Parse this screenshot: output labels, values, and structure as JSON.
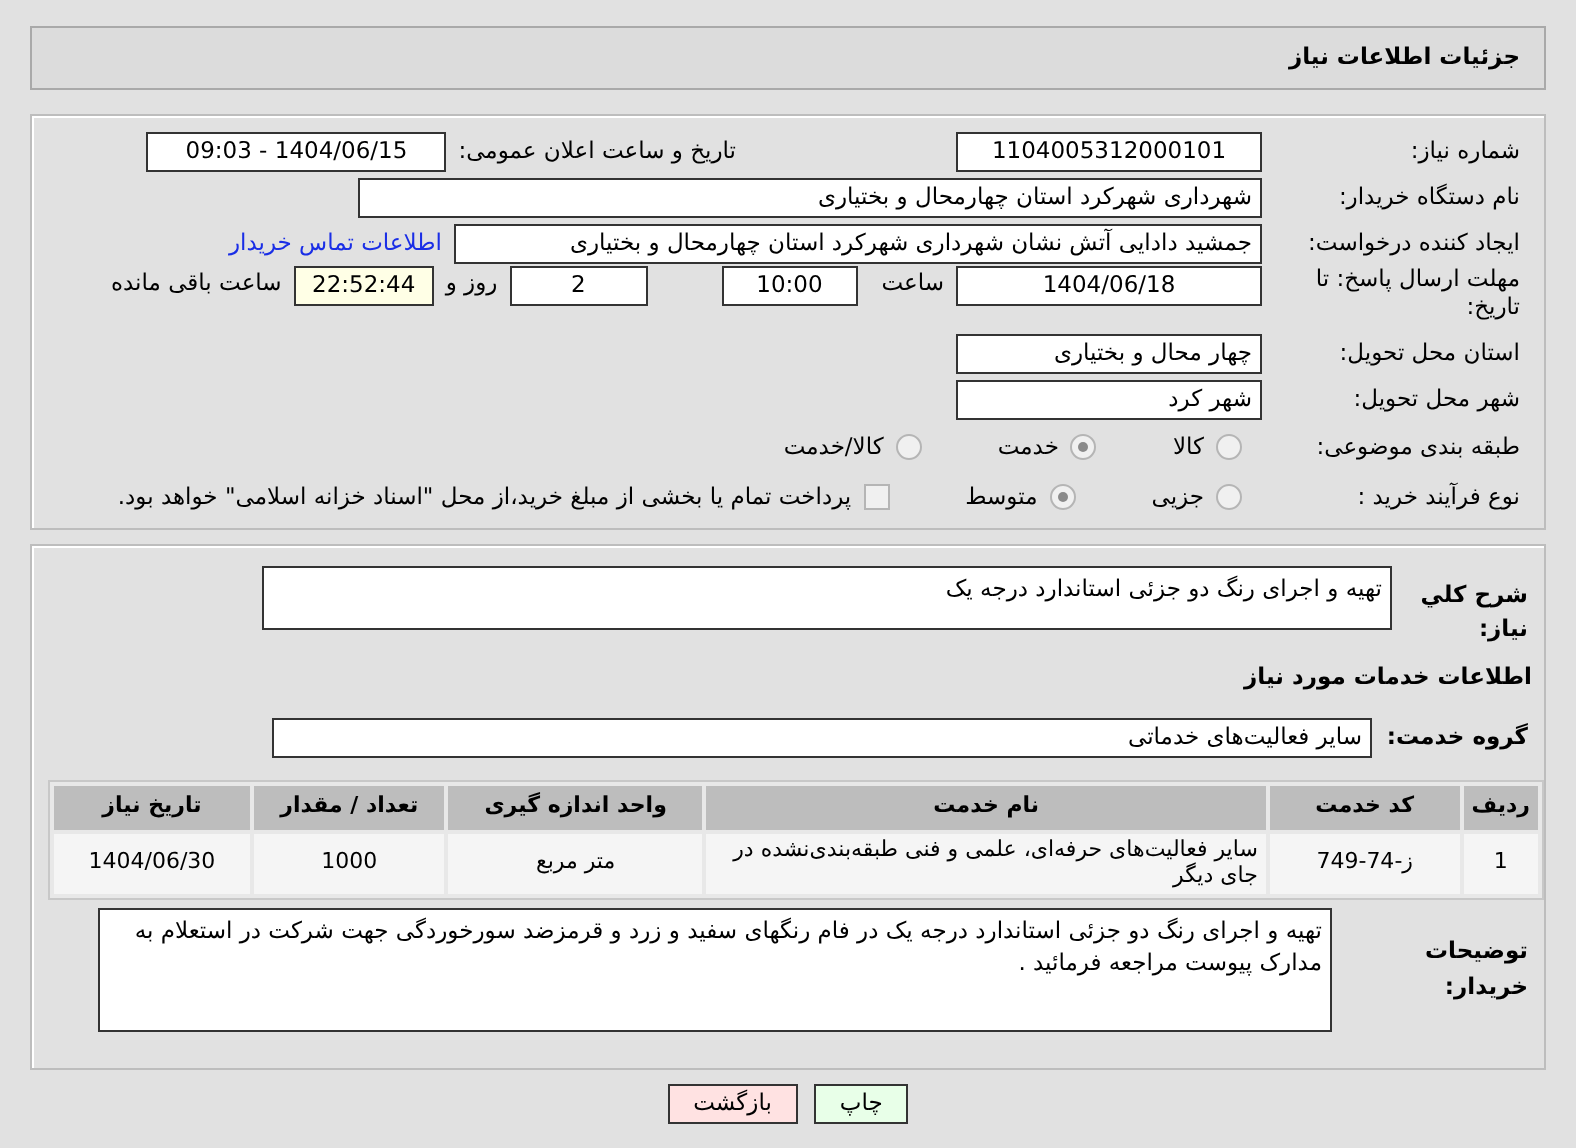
{
  "header": {
    "title": "جزئیات اطلاعات نیاز"
  },
  "need_number": {
    "label": "شماره نیاز:",
    "value": "1104005312000101"
  },
  "announce": {
    "label": "تاریخ و ساعت اعلان عمومی:",
    "value": "1404/06/15 - 09:03"
  },
  "buyer_org": {
    "label": "نام دستگاه خریدار:",
    "value": "شهرداری شهرکرد استان چهارمحال و بختیاری"
  },
  "requester": {
    "label": "ایجاد کننده درخواست:",
    "value": "جمشید دادایی آتش نشان شهرداری شهرکرد استان چهارمحال و بختیاری",
    "link": "اطلاعات تماس خریدار"
  },
  "deadline": {
    "label": "مهلت ارسال پاسخ: تا تاریخ:",
    "date": "1404/06/18",
    "time_label": "ساعت",
    "time": "10:00",
    "days": "2",
    "days_label": "روز و",
    "remaining": "22:52:44",
    "remaining_label": "ساعت باقی مانده"
  },
  "province": {
    "label": "استان محل تحویل:",
    "value": "چهار محال و بختیاری"
  },
  "city": {
    "label": "شهر محل تحویل:",
    "value": "شهر کرد"
  },
  "category": {
    "label": "طبقه بندی موضوعی:",
    "options": [
      {
        "label": "کالا",
        "selected": false
      },
      {
        "label": "خدمت",
        "selected": true
      },
      {
        "label": "کالا/خدمت",
        "selected": false
      }
    ]
  },
  "process": {
    "label": "نوع فرآیند خرید :",
    "options": [
      {
        "label": "جزیی",
        "selected": false
      },
      {
        "label": "متوسط",
        "selected": true
      }
    ],
    "payment": {
      "label": "پرداخت تمام یا بخشی از مبلغ خرید،از محل \"اسناد خزانه اسلامی\" خواهد بود.",
      "checked": false
    }
  },
  "summary": {
    "label": "شرح کلي نیاز:",
    "value": "تهیه و اجرای رنگ دو جزئی استاندارد درجه یک"
  },
  "services_heading": "اطلاعات خدمات مورد نیاز",
  "service_group": {
    "label": "گروه خدمت:",
    "value": "سایر فعالیت‌های خدماتی"
  },
  "table": {
    "columns": [
      "ردیف",
      "کد خدمت",
      "نام خدمت",
      "واحد اندازه گیری",
      "تعداد / مقدار",
      "تاریخ نیاز"
    ],
    "rows": [
      [
        "1",
        "ز-74-749",
        "سایر فعالیت‌های حرفه‌ای، علمی و فنی طبقه‌بندی‌نشده در جای دیگر",
        "متر مربع",
        "1000",
        "1404/06/30"
      ]
    ]
  },
  "buyer_notes": {
    "label": "توضیحات خریدار:",
    "value": "تهیه و اجرای رنگ دو جزئی استاندارد درجه یک در فام رنگهای سفید و زرد و قرمزضد سورخوردگی جهت شرکت در استعلام به مدارک پیوست مراجعه فرمائید ."
  },
  "buttons": [
    {
      "label": "چاپ",
      "kind": "print"
    },
    {
      "label": "بازگشت",
      "kind": "back"
    }
  ]
}
